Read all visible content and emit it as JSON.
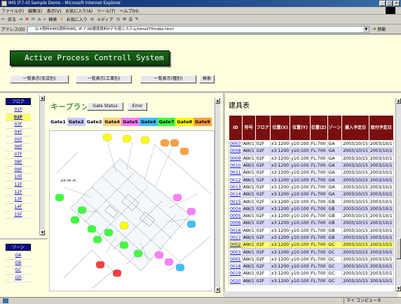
{
  "window": {
    "title": "IMS [F7-II] Sample Demo - Microsoft Internet Explorer",
    "controls": [
      "_",
      "□",
      "×"
    ]
  },
  "menu": [
    "ファイル(F)",
    "編集(E)",
    "表示(V)",
    "お気に入り(A)",
    "ツール(T)",
    "ヘルプ(H)"
  ],
  "toolbar": {
    "back": "戻る",
    "search": "検索",
    "favorites": "お気に入り",
    "media": "メディア"
  },
  "address": {
    "label": "アドレス(D)",
    "url": "D:¥資料¥IMS資料¥IMS, IF-7 IW環境資料¥デモ用システム¥imsif7¥index.html",
    "go": "移動"
  },
  "header": {
    "banner": "Active Process Controll System",
    "nav": [
      "一覧表示(支店別)",
      "一覧表示(工事別)",
      "一覧表示(種別)",
      "検索"
    ]
  },
  "floors": {
    "label": "フロア",
    "items": [
      "01F",
      "02F",
      "03F",
      "04F",
      "05F",
      "06F",
      "07F",
      "08F",
      "09F",
      "10F",
      "11F",
      "12F",
      "13F",
      "14F",
      "15F"
    ],
    "selected": "02F"
  },
  "zones": {
    "label": "ゾーン",
    "items": [
      "GA",
      "GB",
      "GC",
      "GD"
    ]
  },
  "keyplan": {
    "title": "キープラン",
    "buttons": [
      "Gate Status",
      "Error"
    ],
    "gates": [
      {
        "label": "Gate1",
        "color": "#ffffff"
      },
      {
        "label": "Gate2",
        "color": "#c8c8ff"
      },
      {
        "label": "Gate3",
        "color": "#ffffff"
      },
      {
        "label": "Gate4",
        "color": "#ffd280"
      },
      {
        "label": "Gate5",
        "color": "#ff80ff"
      },
      {
        "label": "Gate6",
        "color": "#40c0ff"
      },
      {
        "label": "Gate7",
        "color": "#40ff40"
      },
      {
        "label": "Gate8",
        "color": "#ffff00"
      },
      {
        "label": "Gate9",
        "color": "#ffa040"
      }
    ],
    "plan_label": "Job-site aA"
  },
  "table": {
    "title": "建具表",
    "headers": [
      "ID",
      "符号",
      "フロア",
      "位置(X)",
      "位置(Y)",
      "位置(Z)",
      "ゾーン",
      "搬入予定日",
      "取付予定日"
    ],
    "rows": [
      [
        "0007",
        "AW/1",
        "02F",
        "x3:1200",
        "y10:100",
        "FL:700",
        "GA",
        "2003/10/15",
        "2003/10/1"
      ],
      [
        "0008",
        "AW/1",
        "02F",
        "x3:1200",
        "y10:100",
        "FL:700",
        "GA",
        "2003/10/15",
        "2003/10/1"
      ],
      [
        "0009",
        "AW/1",
        "02F",
        "x3:1200",
        "y10:100",
        "FL:700",
        "GA",
        "2003/10/15",
        "2003/10/1"
      ],
      [
        "0010",
        "AW/1",
        "02F",
        "x3:1200",
        "y10:100",
        "FL:700",
        "GA",
        "2003/10/15",
        "2003/10/1"
      ],
      [
        "0011",
        "AW/1",
        "02F",
        "x3:1200",
        "y10:100",
        "FL:700",
        "GA",
        "2003/10/15",
        "2003/10/1"
      ],
      [
        "0012",
        "AW/1",
        "02F",
        "x3:1200",
        "y10:100",
        "FL:700",
        "GA",
        "2003/10/15",
        "2003/10/1"
      ],
      [
        "0013",
        "AW/1",
        "02F",
        "x3:1200",
        "y10:100",
        "FL:700",
        "GA",
        "2003/10/15",
        "2003/10/1"
      ],
      [
        "0014",
        "AW/1",
        "02F",
        "x3:1200",
        "y10:100",
        "FL:700",
        "GA",
        "2003/10/15",
        "2003/10/1"
      ],
      [
        "0015",
        "AW/1",
        "02F",
        "x3:1200",
        "y10:100",
        "FL:700",
        "GB",
        "2003/10/15",
        "2003/10/1"
      ],
      [
        "0004",
        "AW/1",
        "02F",
        "x3:1200",
        "y10:100",
        "FL:700",
        "GB",
        "2003/10/15",
        "2003/10/1"
      ],
      [
        "0005",
        "AW/1",
        "02F",
        "x3:1200",
        "y10:100",
        "FL:700",
        "GB",
        "2003/10/15",
        "2003/10/1"
      ],
      [
        "0006",
        "AW/1",
        "02F",
        "x3:1200",
        "y10:100",
        "FL:700",
        "GB",
        "2003/10/15",
        "2003/10/1"
      ],
      [
        "0016",
        "AW/1",
        "02F",
        "x3:1200",
        "y10:100",
        "FL:700",
        "GB",
        "2003/10/15",
        "2003/10/1"
      ],
      [
        "0017",
        "AW/1",
        "02F",
        "x3:1200",
        "y10:100",
        "FL:700",
        "GB",
        "2003/10/15",
        "2003/10/1"
      ],
      [
        "0002",
        "AW/1",
        "02F",
        "x3:1200",
        "y10:100",
        "FL:700",
        "GC",
        "2003/10/15",
        "2003/10/1"
      ],
      [
        "0003",
        "AW/1",
        "02F",
        "x3:1200",
        "y10:100",
        "FL:700",
        "GC",
        "2003/10/15",
        "2003/10/1"
      ],
      [
        "0001",
        "AW/1",
        "02F",
        "x3:1200",
        "y10:100",
        "FL:700",
        "GC",
        "2003/10/15",
        "2003/10/1"
      ],
      [
        "0018",
        "AW/1",
        "02F",
        "x3:1200",
        "y10:100",
        "FL:700",
        "GC",
        "2003/10/15",
        "2003/10/1"
      ],
      [
        "0019",
        "AW/1",
        "02F",
        "x3:1200",
        "y10:100",
        "FL:700",
        "GC",
        "2003/10/15",
        "2003/10/1"
      ],
      [
        "0020",
        "AW/1",
        "02F",
        "x3:1200",
        "y10:100",
        "FL:700",
        "GC",
        "2003/10/15",
        "2003/10/1"
      ]
    ],
    "highlighted_id": "0002"
  },
  "status": {
    "zone": "マイ コンピュータ"
  }
}
